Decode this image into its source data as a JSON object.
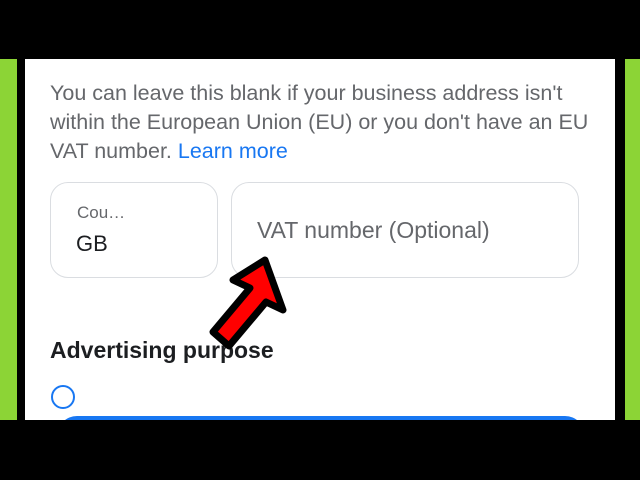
{
  "help": {
    "text": "You can leave this blank if your business address isn't within the European Union (EU) or you don't have an EU VAT number.",
    "link": "Learn more"
  },
  "country_field": {
    "label": "Cou…",
    "value": "GB"
  },
  "vat_field": {
    "placeholder": "VAT number (Optional)"
  },
  "section": {
    "title": "Advertising purpose"
  },
  "annotation": {
    "icon": "red-arrow-icon",
    "color": "#ff0000"
  },
  "colors": {
    "accent": "#1877f2",
    "frame_green": "#8cd436"
  }
}
